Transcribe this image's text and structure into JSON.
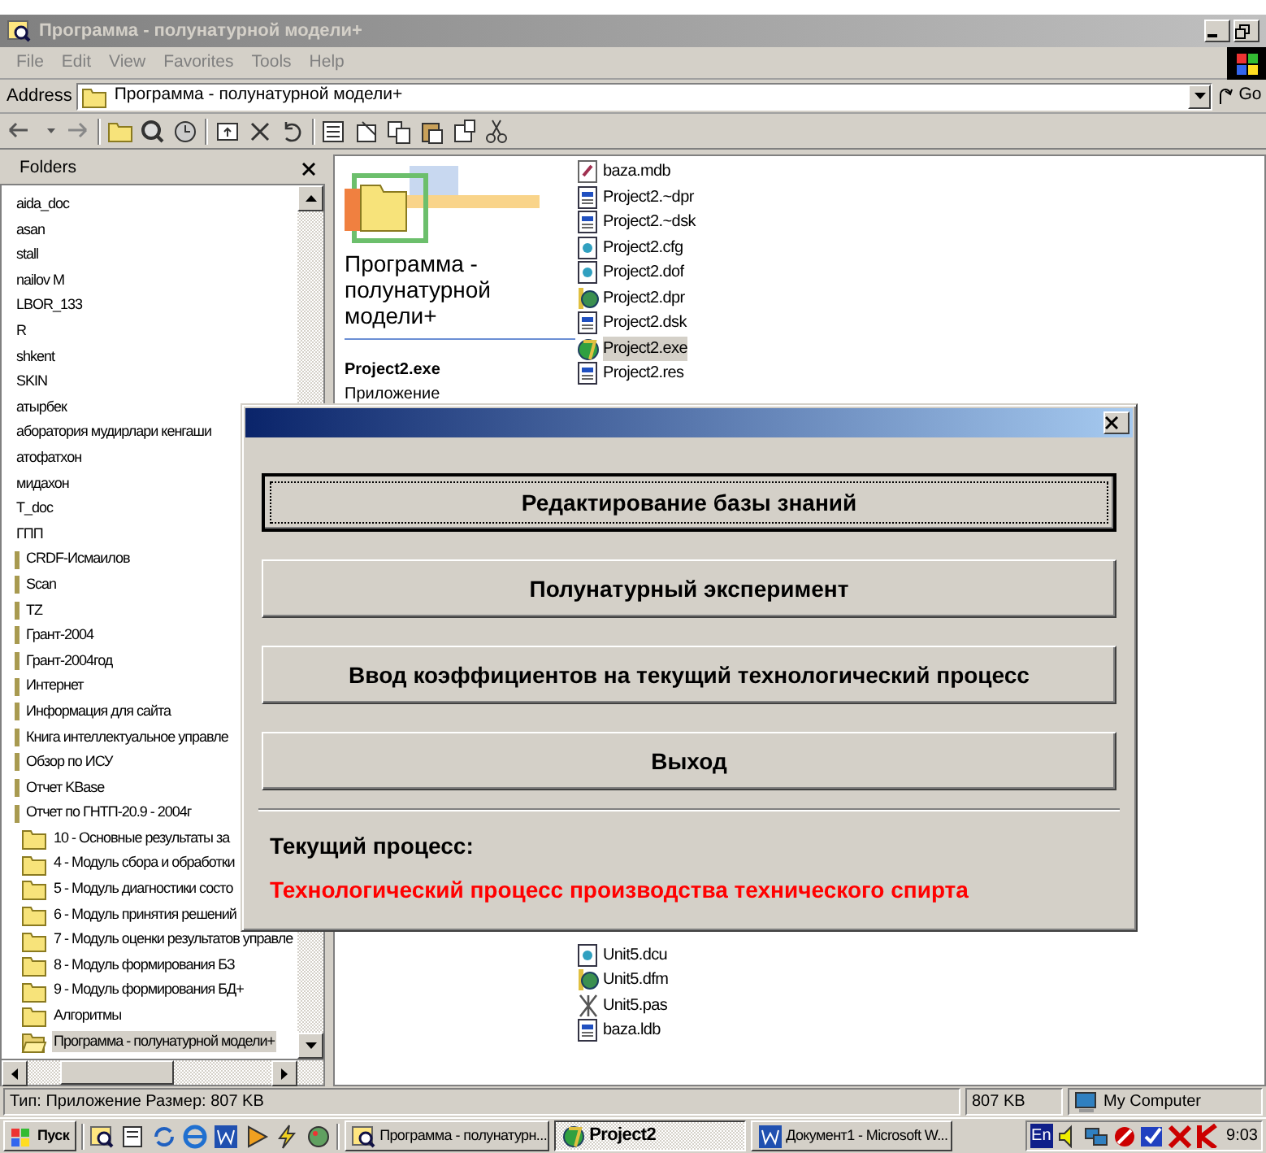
{
  "window": {
    "title": "Программа - полунатурной модели+",
    "menu": [
      "File",
      "Edit",
      "View",
      "Favorites",
      "Tools",
      "Help"
    ],
    "address_label": "Address",
    "address": "Программа - полунатурной модели+",
    "go": "Go"
  },
  "folders": {
    "title": "Folders",
    "items": [
      {
        "label": "aida_doc",
        "kind": "plain",
        "selected": false
      },
      {
        "label": "asan",
        "kind": "plain",
        "selected": false
      },
      {
        "label": "stall",
        "kind": "plain",
        "selected": false
      },
      {
        "label": "nailov M",
        "kind": "plain",
        "selected": false
      },
      {
        "label": "LBOR_133",
        "kind": "plain",
        "selected": false
      },
      {
        "label": "R",
        "kind": "plain",
        "selected": false
      },
      {
        "label": "shkent",
        "kind": "plain",
        "selected": false
      },
      {
        "label": "SKIN",
        "kind": "plain",
        "selected": false
      },
      {
        "label": "атырбек",
        "kind": "plain",
        "selected": false
      },
      {
        "label": "аборатория мудирлари кенгаши",
        "kind": "plain",
        "selected": false
      },
      {
        "label": "атофатхон",
        "kind": "plain",
        "selected": false
      },
      {
        "label": "мидахон",
        "kind": "plain",
        "selected": false
      },
      {
        "label": "T_doc",
        "kind": "plain",
        "selected": false
      },
      {
        "label": "ГПП",
        "kind": "plain",
        "selected": false
      },
      {
        "label": "CRDF-Исмаилов",
        "kind": "stub",
        "selected": false
      },
      {
        "label": "Scan",
        "kind": "stub",
        "selected": false
      },
      {
        "label": "TZ",
        "kind": "stub",
        "selected": false
      },
      {
        "label": "Грант-2004",
        "kind": "stub",
        "selected": false
      },
      {
        "label": "Грант-2004год",
        "kind": "stub",
        "selected": false
      },
      {
        "label": "Интернет",
        "kind": "stub",
        "selected": false
      },
      {
        "label": "Информация для сайта",
        "kind": "stub",
        "selected": false
      },
      {
        "label": "Книга интеллектуальное управле",
        "kind": "stub",
        "selected": false
      },
      {
        "label": "Обзор по ИСУ",
        "kind": "stub",
        "selected": false
      },
      {
        "label": "Отчет KBase",
        "kind": "stub",
        "selected": false
      },
      {
        "label": "Отчет по ГНТП-20.9 - 2004г",
        "kind": "stub",
        "selected": false
      },
      {
        "label": "10 - Основные результаты за",
        "kind": "folder",
        "selected": false
      },
      {
        "label": "4 - Модуль сбора и обработки",
        "kind": "folder",
        "selected": false
      },
      {
        "label": "5 - Модуль диагностики состо",
        "kind": "folder",
        "selected": false
      },
      {
        "label": "6 - Модуль принятия решений",
        "kind": "folder",
        "selected": false
      },
      {
        "label": "7 - Модуль оценки результатов управле",
        "kind": "folder",
        "selected": false
      },
      {
        "label": "8 - Модуль формирования БЗ",
        "kind": "folder",
        "selected": false
      },
      {
        "label": "9 - Модуль формирования БД+",
        "kind": "folder",
        "selected": false
      },
      {
        "label": "Алгоритмы",
        "kind": "folder",
        "selected": false
      },
      {
        "label": "Программа - полунатурной модели+",
        "kind": "folder",
        "selected": true
      }
    ]
  },
  "preview": {
    "title": "Программа - полунатурной модели+",
    "file_name": "Project2.exe",
    "file_type": "Приложение"
  },
  "files_top": [
    {
      "name": "baza.mdb",
      "kind": "database",
      "selected": false
    },
    {
      "name": "Project2.~dpr",
      "kind": "doc",
      "selected": false
    },
    {
      "name": "Project2.~dsk",
      "kind": "doc",
      "selected": false
    },
    {
      "name": "Project2.cfg",
      "kind": "config",
      "selected": false
    },
    {
      "name": "Project2.dof",
      "kind": "config",
      "selected": false
    },
    {
      "name": "Project2.dpr",
      "kind": "delphi",
      "selected": false
    },
    {
      "name": "Project2.dsk",
      "kind": "doc",
      "selected": false
    },
    {
      "name": "Project2.exe",
      "kind": "app",
      "selected": true
    },
    {
      "name": "Project2.res",
      "kind": "doc",
      "selected": false
    }
  ],
  "files_bottom": [
    {
      "name": "Unit5.dcu",
      "kind": "config",
      "selected": false
    },
    {
      "name": "Unit5.dfm",
      "kind": "delphi",
      "selected": false
    },
    {
      "name": "Unit5.pas",
      "kind": "source",
      "selected": false
    },
    {
      "name": "baza.ldb",
      "kind": "doc",
      "selected": false
    }
  ],
  "dialog": {
    "buttons": [
      {
        "label": "Редактирование базы знаний",
        "focused": true
      },
      {
        "label": "Полунатурный эксперимент",
        "focused": false
      },
      {
        "label": "Ввод коэффициентов на текущий технологический процесс",
        "focused": false
      },
      {
        "label": "Выход",
        "focused": false
      }
    ],
    "process_label": "Текущий процесс:",
    "process": "Технологический процесс производства технического спирта"
  },
  "status_bar": {
    "info": "Тип: Приложение Размер: 807 KB",
    "size": "807 KB",
    "zone": "My Computer"
  },
  "taskbar": {
    "start": "Пуск",
    "tasks": [
      {
        "label": "Программа - полунатурн...",
        "active": false
      },
      {
        "label": "Project2",
        "active": true
      },
      {
        "label": "Документ1 - Microsoft W...",
        "active": false
      }
    ],
    "language": "En",
    "clock": "9:03"
  }
}
